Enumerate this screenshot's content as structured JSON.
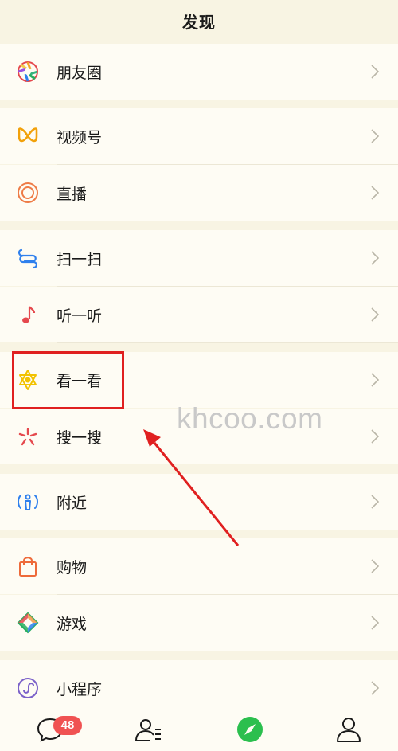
{
  "header": {
    "title": "发现"
  },
  "menu": {
    "moments": "朋友圈",
    "channels": "视频号",
    "live": "直播",
    "scan": "扫一扫",
    "listen": "听一听",
    "top_stories": "看一看",
    "search": "搜一搜",
    "nearby": "附近",
    "shopping": "购物",
    "games": "游戏",
    "mini_programs": "小程序"
  },
  "icons": {
    "moments": "aperture-icon",
    "channels": "butterfly-icon",
    "live": "live-ring-icon",
    "scan": "scan-icon",
    "listen": "music-note-icon",
    "top_stories": "star-flower-icon",
    "search": "asterisk-icon",
    "nearby": "radar-person-icon",
    "shopping": "bag-icon",
    "games": "diamond-icon",
    "mini_programs": "mini-program-icon",
    "chevron": "chevron-right-icon"
  },
  "watermark": "khcoo.com",
  "tabbar": {
    "chats_badge": "48",
    "tabs": [
      "chat-icon",
      "contacts-icon",
      "discover-icon",
      "me-icon"
    ]
  },
  "colors": {
    "background": "#f8f4e3",
    "row": "#fefcf4",
    "highlight": "#e02020",
    "badge": "#f05252",
    "discover_active": "#2bbf4e"
  }
}
